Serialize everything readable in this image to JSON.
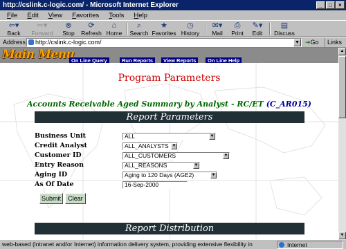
{
  "window": {
    "title": "http://cslink.c-logic.com/ - Microsoft Internet Explorer",
    "controls": [
      "_",
      "□",
      "×"
    ]
  },
  "menubar": [
    "File",
    "Edit",
    "View",
    "Favorites",
    "Tools",
    "Help"
  ],
  "toolbar": {
    "back": "Back",
    "forward": "Forward",
    "stop": "Stop",
    "refresh": "Refresh",
    "home": "Home",
    "search": "Search",
    "favorites": "Favorites",
    "history": "History",
    "mail": "Mail",
    "print": "Print",
    "edit": "Edit",
    "discuss": "Discuss"
  },
  "addressbar": {
    "label": "Address",
    "url": "http://cslink.c-logic.com/",
    "go": "Go",
    "links": "Links »"
  },
  "nav": {
    "logo": "Main Menu",
    "items": [
      "On Line Query",
      "Run Reports",
      "View Reports",
      "On Line Help"
    ]
  },
  "page": {
    "heading": "Program Parameters",
    "report_title": "Accounts Receivable Aged Summary by Analyst - RC/ET",
    "report_code": "(C_AR015)",
    "section_parameters": "Report Parameters",
    "section_distribution": "Report Distribution"
  },
  "form": {
    "fields": [
      {
        "label": "Business Unit",
        "value": "ALL"
      },
      {
        "label": "Credit Analyst",
        "value": "ALL_ANALYSTS"
      },
      {
        "label": "Customer ID",
        "value": "ALL_CUSTOMERS"
      },
      {
        "label": "Entry Reason",
        "value": "ALL_REASONS"
      },
      {
        "label": "Aging ID",
        "value": "Aging to 120 Days (AGE2)"
      },
      {
        "label": "As Of Date",
        "value": "16-Sep-2000"
      }
    ],
    "submit": "Submit",
    "clear": "Clear"
  },
  "statusbar": {
    "text": "web-based (intranet and/or Internet) information delivery system, providing extensive flexibility in",
    "zone": "Internet"
  },
  "colors": {
    "titlebar": "#0a246a",
    "nav_button": "#000080",
    "heading": "#cc0000",
    "report_title": "#006600",
    "report_code": "#000099",
    "section_band": "#203034"
  }
}
